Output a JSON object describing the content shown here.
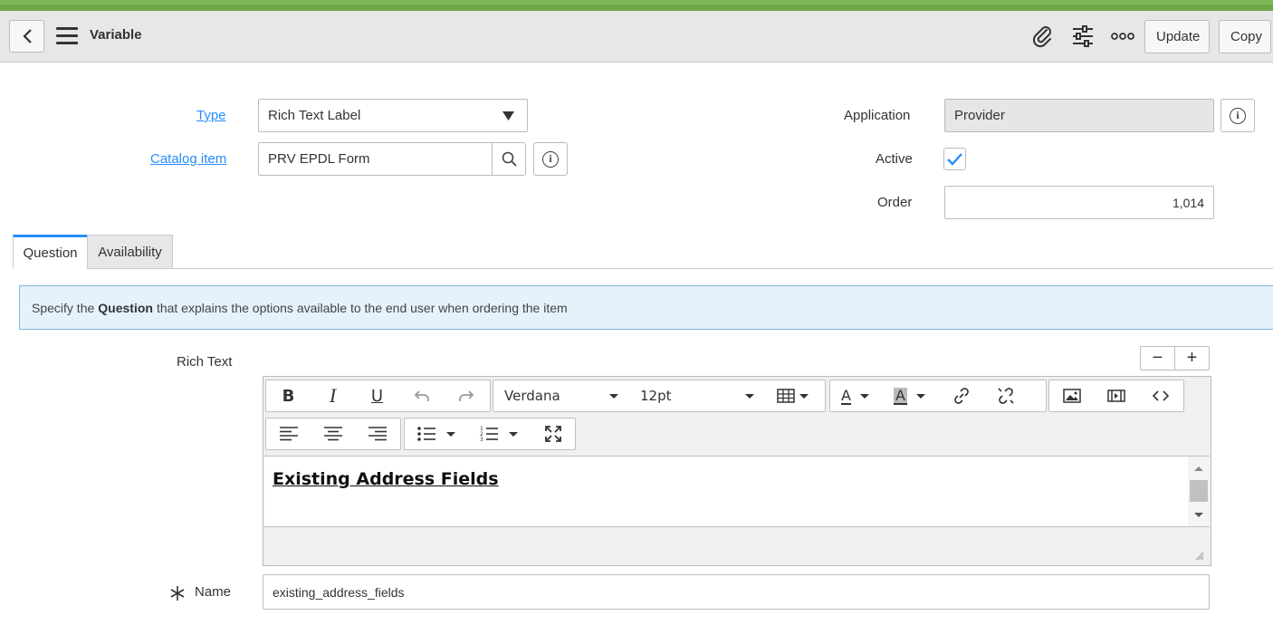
{
  "header": {
    "title": "Variable",
    "update_label": "Update",
    "copy_label": "Copy"
  },
  "form": {
    "type": {
      "label": "Type",
      "value": "Rich Text Label"
    },
    "catalog_item": {
      "label": "Catalog item",
      "value": "PRV EPDL Form"
    },
    "application": {
      "label": "Application",
      "value": "Provider"
    },
    "active": {
      "label": "Active",
      "checked": true
    },
    "order": {
      "label": "Order",
      "value": "1,014"
    }
  },
  "tabs": [
    {
      "label": "Question",
      "active": true
    },
    {
      "label": "Availability",
      "active": false
    }
  ],
  "info_banner": {
    "prefix": "Specify the",
    "bold": "Question",
    "suffix": "that explains the options available to the end user when ordering the item"
  },
  "rich_text": {
    "label": "Rich Text",
    "font": "Verdana",
    "size": "12pt",
    "content": "Existing Address Fields"
  },
  "name": {
    "label": "Name",
    "value": "existing_address_fields"
  },
  "colors": {
    "accent": "#278efc",
    "topbar": "#6ea848",
    "banner_bg": "#e5f2fb"
  }
}
